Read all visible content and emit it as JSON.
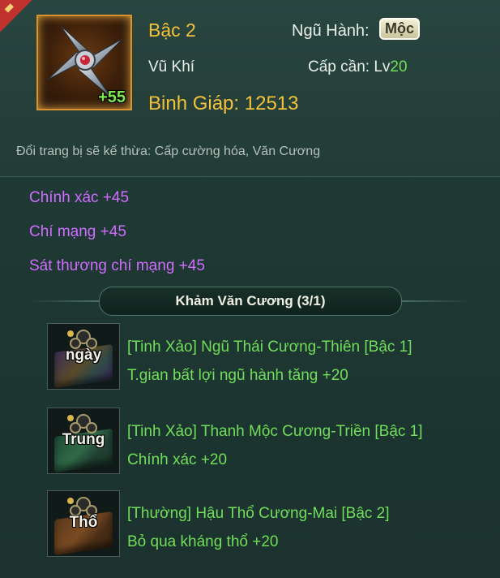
{
  "item": {
    "level_bonus": "+55",
    "tier": "Bậc 2",
    "category": "Vũ Khí",
    "power_label": "Binh Giáp:",
    "power_value": "12513",
    "element_label": "Ngũ Hành:",
    "element_value": "Mộc",
    "req_label": "Cấp cần:",
    "req_prefix": "Lv",
    "req_value": "20",
    "inherit_note": "Đổi trang bị sẽ kế thừa: Cấp cường hóa, Văn Cương"
  },
  "stats": [
    {
      "name": "Chính xác",
      "value": "+45"
    },
    {
      "name": "Chí mạng",
      "value": "+45"
    },
    {
      "name": "Sát thương chí mạng",
      "value": "+45"
    }
  ],
  "inlay": {
    "title": "Khảm Văn Cương (3/1)",
    "gems": [
      {
        "label": "ngày",
        "name": "[Tinh Xảo] Ngũ Thái Cương-Thiên [Bậc 1]",
        "effect": "T.gian bất lợi ngũ hành tăng +20"
      },
      {
        "label": "Trung",
        "name": "[Tinh Xảo] Thanh Mộc Cương-Triền [Bậc 1]",
        "effect": "Chính xác +20"
      },
      {
        "label": "Thổ",
        "name": "[Thường] Hậu Thổ Cương-Mai [Bậc 2]",
        "effect": "Bỏ qua kháng thổ +20"
      }
    ]
  },
  "colors": {
    "gold": "#f2c23b",
    "purple": "#cf6dff",
    "green": "#71de5a",
    "badge_red": "#c0322e"
  },
  "icons": {
    "item": "shuriken-icon",
    "gem_ornament": "bead-knot-icon"
  }
}
